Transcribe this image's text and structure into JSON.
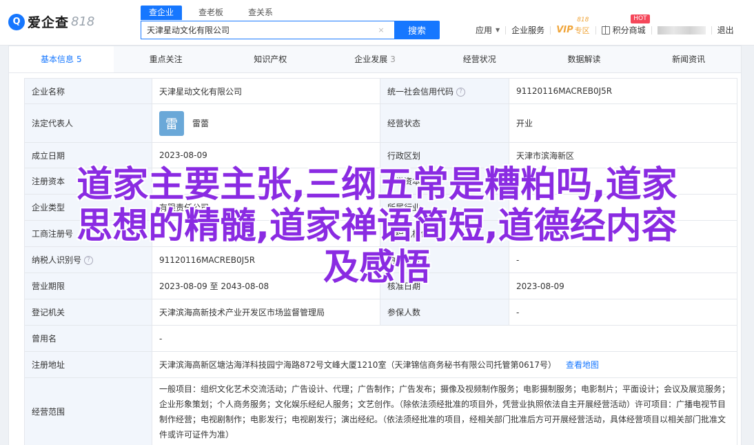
{
  "brand": {
    "mark": "Q",
    "name": "爱企查",
    "suffix": "818"
  },
  "tabs": [
    {
      "label": "查企业"
    },
    {
      "label": "查老板"
    },
    {
      "label": "查关系"
    }
  ],
  "search": {
    "value": "天津星动文化有限公司",
    "clear": "×",
    "button": "搜索"
  },
  "topnav": {
    "app": "应用",
    "enterprise_service": "企业服务",
    "vip": "VIP",
    "vip_sub": "专区",
    "vip_num": "818",
    "hot": "HOT",
    "points_mall": "积分商城",
    "logout": "退出"
  },
  "subtabs": [
    {
      "label": "基本信息",
      "count": "5"
    },
    {
      "label": "重点关注",
      "count": ""
    },
    {
      "label": "知识产权",
      "count": ""
    },
    {
      "label": "企业发展",
      "count": "3"
    },
    {
      "label": "经营状况",
      "count": ""
    },
    {
      "label": "数据解读",
      "count": ""
    },
    {
      "label": "新闻资讯",
      "count": ""
    }
  ],
  "info": {
    "company_name_label": "企业名称",
    "company_name": "天津星动文化有限公司",
    "credit_code_label": "统一社会信用代码",
    "credit_code": "91120116MACREB0J5R",
    "legal_rep_label": "法定代表人",
    "legal_rep_avatar": "雷",
    "legal_rep": "雷蕾",
    "status_label": "经营状态",
    "status": "开业",
    "established_label": "成立日期",
    "established": "2023-08-09",
    "region_label": "行政区划",
    "region": "天津市滨海新区",
    "capital_label": "注册资本",
    "capital": "",
    "paid_label": "实缴资本",
    "paid": "",
    "type_label": "企业类型",
    "type": "有限责任公司",
    "industry_label": "所属行业",
    "industry": "",
    "reg_no_label": "工商注册号",
    "reg_no": "",
    "org_code_label": "组织机构代码",
    "org_code": "",
    "taxpayer_label": "纳税人识别号",
    "taxpayer": "91120116MACREB0J5R",
    "taxpayer_qual_label": "纳税人资质",
    "taxpayer_qual": "-",
    "term_label": "营业期限",
    "term": "2023-08-09 至 2043-08-08",
    "approval_label": "核准日期",
    "approval": "2023-08-09",
    "authority_label": "登记机关",
    "authority": "天津滨海高新技术产业开发区市场监督管理局",
    "insured_label": "参保人数",
    "insured": "-",
    "former_name_label": "曾用名",
    "former_name": "-",
    "address_label": "注册地址",
    "address": "天津滨海高新区塘沽海洋科技园宁海路872号文峰大厦1210室（天津锦信商务秘书有限公司托管第0617号）",
    "map_link": "查看地图",
    "scope_label": "经营范围",
    "scope": "一般项目：组织文化艺术交流活动；广告设计、代理；广告制作；广告发布；摄像及视频制作服务；电影摄制服务；电影制片；平面设计；会议及展览服务；企业形象策划；个人商务服务；文化娱乐经纪人服务；文艺创作。（除依法须经批准的项目外，凭营业执照依法自主开展经营活动）许可项目：广播电视节目制作经营；电视剧制作；电影发行；电视剧发行；演出经纪。（依法须经批准的项目，经相关部门批准后方可开展经营活动，具体经营项目以相关部门批准文件或许可证件为准）"
  },
  "overlay": {
    "line1": "道家主要主张,三纲五常是糟粕吗,道家",
    "line2": "思想的精髓,道家禅语简短,道德经内容",
    "line3": "及感悟"
  }
}
